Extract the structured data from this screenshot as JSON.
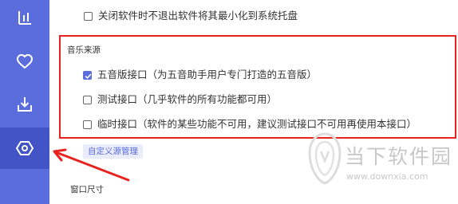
{
  "sidebar": {
    "items": [
      {
        "icon": "bar-chart-icon",
        "active": false
      },
      {
        "icon": "heart-icon",
        "active": false
      },
      {
        "icon": "download-icon",
        "active": false
      },
      {
        "icon": "settings-hexagon-icon",
        "active": true
      }
    ],
    "background_color": "#5b6cdc",
    "active_color": "#4354c7"
  },
  "general": {
    "minimize_to_tray": {
      "label": "关闭软件时不退出软件将其最小化到系统托盘",
      "checked": false
    }
  },
  "music_source": {
    "title": "音乐来源",
    "options": [
      {
        "label": "五音版接口（为五音助手用户专门打造的五音版）",
        "checked": true
      },
      {
        "label": "测试接口（几乎软件的所有功能都可用）",
        "checked": false
      },
      {
        "label": "临时接口（软件的某些功能不可用，建议测试接口不可用再使用本接口）",
        "checked": false
      }
    ],
    "highlight_color": "#e8231f",
    "custom_source_button": "自定义源管理"
  },
  "window_size": {
    "title": "窗口尺寸"
  },
  "watermark": {
    "title": "当下软件园",
    "url": "www.downxia.com"
  },
  "accent_color": "#5b6cdc"
}
